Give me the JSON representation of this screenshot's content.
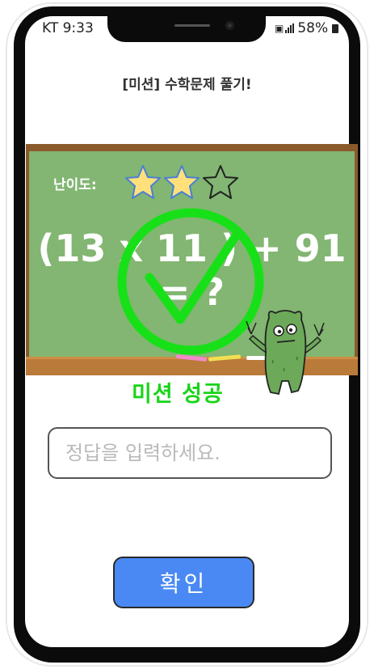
{
  "status_bar": {
    "carrier_time": "KT 9:33",
    "battery": "58%"
  },
  "mission": {
    "title": "[미션] 수학문제 풀기!"
  },
  "board": {
    "difficulty_label": "난이도:",
    "difficulty_rating": 2,
    "difficulty_max": 3,
    "problem_line1": "(13 x 11 ) + 91",
    "problem_line2": "= ?"
  },
  "result": {
    "success_text": "미션 성공"
  },
  "answer": {
    "placeholder": "정답을 입력하세요.",
    "value": ""
  },
  "confirm": {
    "label": "확인"
  },
  "colors": {
    "board_green": "#82b672",
    "board_frame": "#8a5a2b",
    "success_green": "#18d418",
    "button_blue": "#4a89f3",
    "star_fill": "#ffe07a"
  }
}
